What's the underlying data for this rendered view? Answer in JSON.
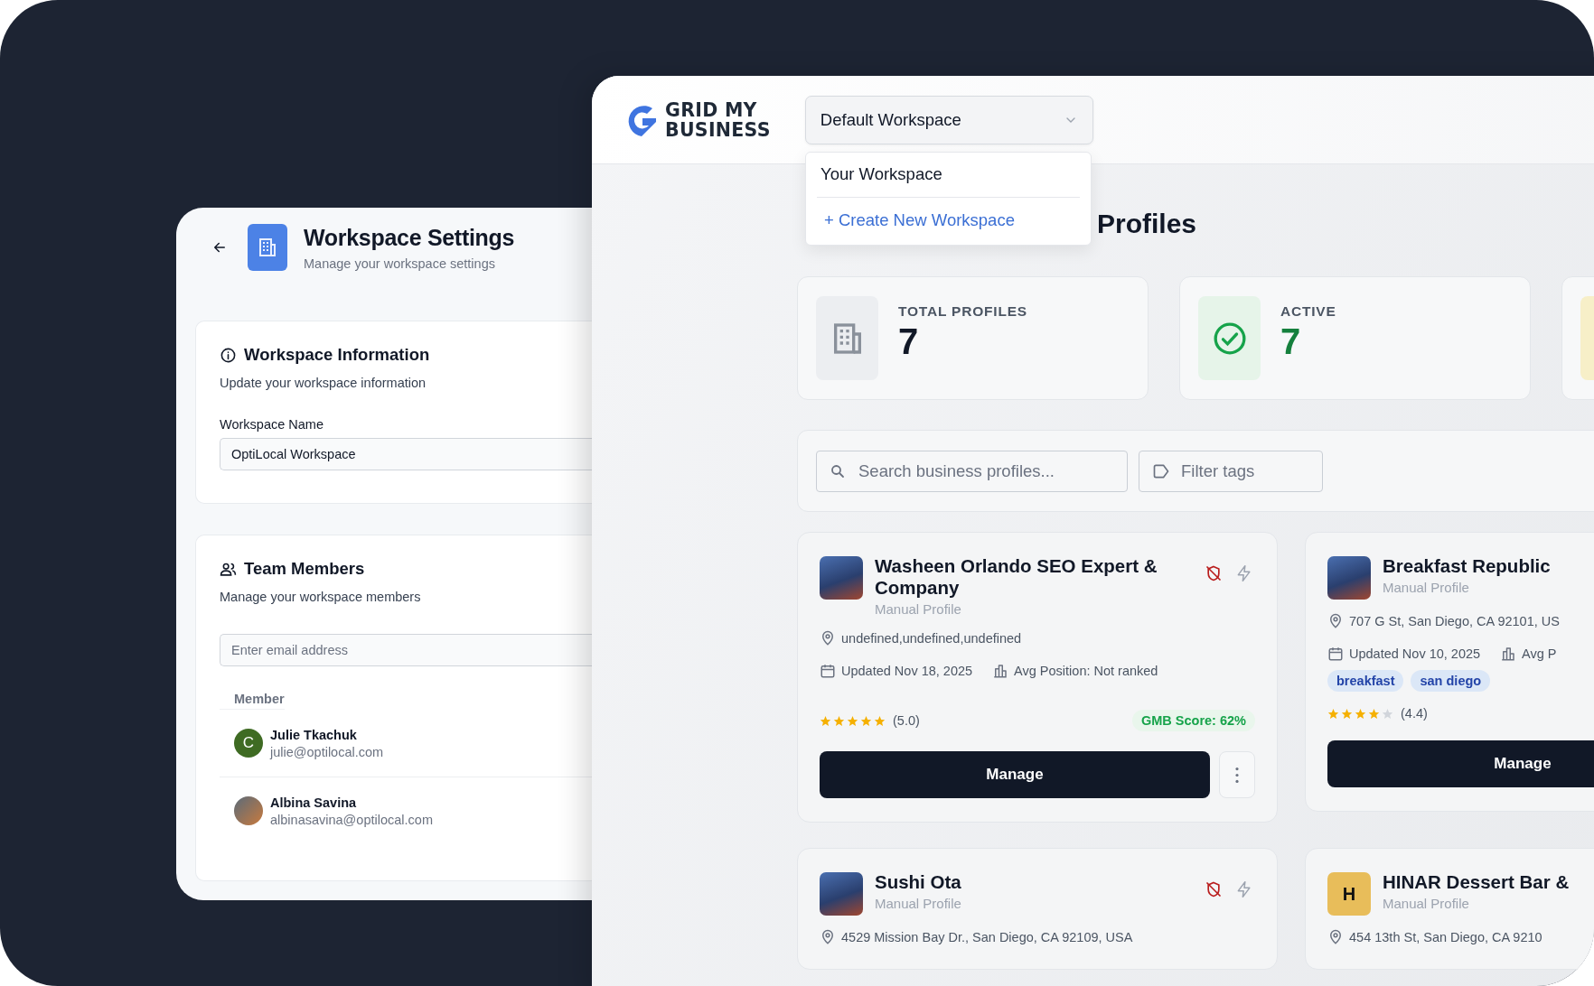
{
  "settings": {
    "title": "Workspace Settings",
    "subtitle": "Manage your workspace settings",
    "info": {
      "title": "Workspace Information",
      "subtitle": "Update your workspace information",
      "field_label": "Workspace Name",
      "field_value": "OptiLocal Workspace"
    },
    "team": {
      "title": "Team Members",
      "subtitle": "Manage your workspace members",
      "email_placeholder": "Enter email address",
      "column": "Member",
      "members": [
        {
          "name": "Julie Tkachuk",
          "email": "julie@optilocal.com",
          "kind": "initial",
          "initial": "C"
        },
        {
          "name": "Albina Savina",
          "email": "albinasavina@optilocal.com",
          "kind": "photo"
        }
      ]
    }
  },
  "main": {
    "logo_lines": [
      "GRID MY",
      "BUSINESS"
    ],
    "workspace_select": {
      "value": "Default Workspace",
      "expanded": true,
      "options": [
        {
          "label": "Your Workspace",
          "kind": "option"
        },
        {
          "label": "+ Create New Workspace",
          "kind": "action"
        }
      ]
    },
    "heading": "Profiles",
    "stats": [
      {
        "kind": "total",
        "label": "TOTAL PROFILES",
        "value": "7"
      },
      {
        "kind": "active",
        "label": "ACTIVE",
        "value": "7"
      },
      {
        "kind": "partial"
      }
    ],
    "search": {
      "placeholder": "Search business profiles..."
    },
    "tag_filter": {
      "placeholder": "Filter tags"
    },
    "profiles": [
      {
        "kind": "photo",
        "name": "Washeen Orlando SEO Expert & Company",
        "type": "Manual Profile",
        "address": "undefined,undefined,undefined",
        "updated": "Updated Nov 18, 2025",
        "avg_position": "Avg Position: Not ranked",
        "stars": 5,
        "rating": "(5.0)",
        "gmb_score": "GMB Score: 62%",
        "button": "Manage"
      },
      {
        "kind": "photo",
        "name": "Breakfast Republic",
        "type": "Manual Profile",
        "address": "707 G St, San Diego, CA 92101, US",
        "updated": "Updated Nov 10, 2025",
        "avg_position": "Avg P",
        "tags": [
          "breakfast",
          "san diego"
        ],
        "stars": 4,
        "rating": "(4.4)",
        "button": "Manage"
      },
      {
        "kind": "photo",
        "name": "Sushi Ota",
        "type": "Manual Profile",
        "address": "4529 Mission Bay Dr., San Diego, CA 92109, USA"
      },
      {
        "kind": "letter",
        "name": "HINAR Dessert Bar &",
        "type": "Manual Profile",
        "letter": "H",
        "address": "454 13th St, San Diego, CA 9210"
      }
    ]
  }
}
